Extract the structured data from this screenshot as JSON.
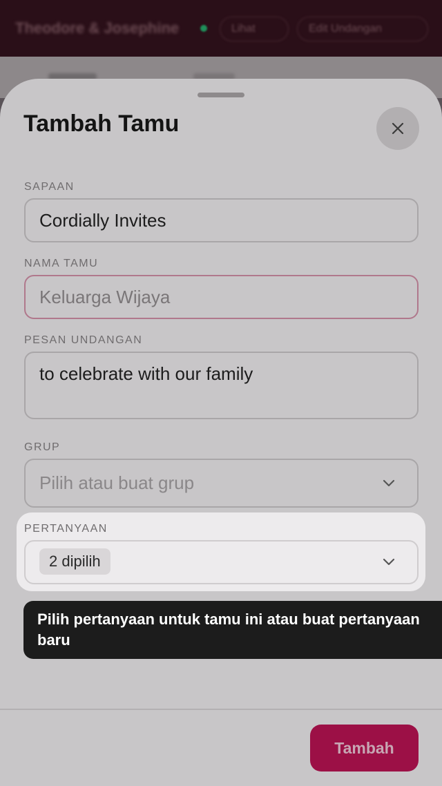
{
  "background": {
    "app_title": "Theodore & Josephine",
    "actions": [
      "Lihat",
      "Edit Undangan"
    ]
  },
  "sheet": {
    "title": "Tambah Tamu",
    "close_icon": "close-icon"
  },
  "form": {
    "sapaan": {
      "label": "SAPAAN",
      "value": "Cordially Invites"
    },
    "nama_tamu": {
      "label": "NAMA TAMU",
      "placeholder": "Keluarga Wijaya"
    },
    "pesan": {
      "label": "PESAN UNDANGAN",
      "value": "to celebrate with our family"
    },
    "grup": {
      "label": "GRUP",
      "placeholder": "Pilih atau buat grup"
    },
    "pertanyaan": {
      "label": "PERTANYAAN",
      "selected": "2 dipilih"
    }
  },
  "tooltip": {
    "text": "Pilih pertanyaan untuk tamu ini atau buat pertanyaan baru"
  },
  "footer": {
    "submit_label": "Tambah"
  },
  "colors": {
    "accent": "#9c1046",
    "tooltip_bg": "#1c1c1c",
    "error_border": "#b0788c"
  }
}
